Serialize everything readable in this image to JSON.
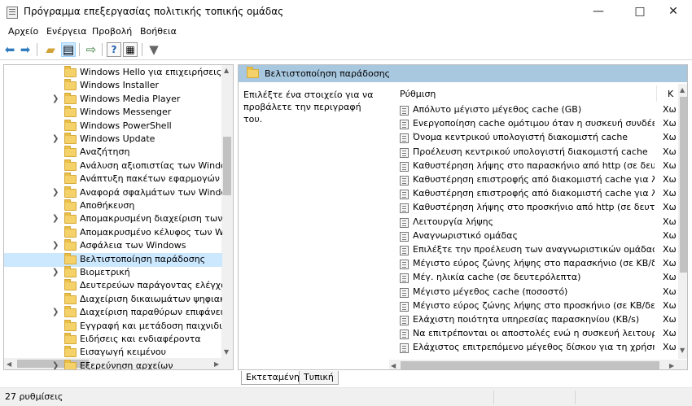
{
  "window": {
    "title": "Πρόγραμμα επεξεργασίας πολιτικής τοπικής ομάδας"
  },
  "menu": [
    "Αρχείο",
    "Ενέργεια",
    "Προβολή",
    "Βοήθεια"
  ],
  "toolbar_icons": [
    "back-arrow-icon",
    "forward-arrow-icon",
    "up-folder-icon",
    "show-tree-icon",
    "export-list-icon",
    "help-icon",
    "properties-icon",
    "filter-icon"
  ],
  "tree": [
    {
      "label": "Windows Hello για επιχειρήσεις",
      "expandable": false
    },
    {
      "label": "Windows Installer",
      "expandable": false
    },
    {
      "label": "Windows Media Player",
      "expandable": true
    },
    {
      "label": "Windows Messenger",
      "expandable": false
    },
    {
      "label": "Windows PowerShell",
      "expandable": false
    },
    {
      "label": "Windows Update",
      "expandable": true
    },
    {
      "label": "Αναζήτηση",
      "expandable": false
    },
    {
      "label": "Ανάλυση αξιοπιστίας των Windows",
      "expandable": false
    },
    {
      "label": "Ανάπτυξη πακέτων εφαρμογών",
      "expandable": false
    },
    {
      "label": "Αναφορά σφαλμάτων των Windows",
      "expandable": true
    },
    {
      "label": "Αποθήκευση",
      "expandable": false
    },
    {
      "label": "Απομακρυσμένη διαχείριση των Wi",
      "expandable": true
    },
    {
      "label": "Απομακρυσμένο κέλυφος των Wind",
      "expandable": false
    },
    {
      "label": "Ασφάλεια των Windows",
      "expandable": true
    },
    {
      "label": "Βελτιστοποίηση παράδοσης",
      "expandable": false,
      "selected": true
    },
    {
      "label": "Βιομετρική",
      "expandable": true
    },
    {
      "label": "Δευτερεύων παράγοντας ελέγχου τ",
      "expandable": false
    },
    {
      "label": "Διαχείριση δικαιωμάτων ψηφιακού",
      "expandable": false
    },
    {
      "label": "Διαχείριση παραθύρων επιφάνειας",
      "expandable": true
    },
    {
      "label": "Εγγραφή και μετάδοση παιχνιδιών",
      "expandable": false
    },
    {
      "label": "Ειδήσεις και ενδιαφέροντα",
      "expandable": false
    },
    {
      "label": "Εισαγωγή κειμένου",
      "expandable": false
    },
    {
      "label": "Εξερεύνηση αρχείων",
      "expandable": true
    }
  ],
  "right_title": "Βελτιστοποίηση παράδοσης",
  "description": "Επιλέξτε ένα στοιχείο για να προβάλετε την περιγραφή του.",
  "columns": {
    "setting": "Ρύθμιση",
    "state": "Κ"
  },
  "settings": [
    {
      "label": "Απόλυτο μέγιστο μέγεθος cache (GB)",
      "state": "Χω"
    },
    {
      "label": "Ενεργοποίηση cache ομότιμου όταν η συσκευή συνδέεται ...",
      "state": "Χω"
    },
    {
      "label": "Όνομα κεντρικού υπολογιστή διακομιστή cache",
      "state": "Χω"
    },
    {
      "label": "Προέλευση κεντρικού υπολογιστή διακομιστή cache",
      "state": "Χω"
    },
    {
      "label": "Καθυστέρηση λήψης στο παρασκήνιο από http (σε δευτερ...",
      "state": "Χω"
    },
    {
      "label": "Καθυστέρηση επιστροφής από διακομιστή cache για λήψη...",
      "state": "Χω"
    },
    {
      "label": "Καθυστέρηση επιστροφής από διακομιστή cache για λήψη...",
      "state": "Χω"
    },
    {
      "label": "Καθυστέρηση λήψης στο προσκήνιο από http (σε δευτερο...",
      "state": "Χω"
    },
    {
      "label": "Λειτουργία λήψης",
      "state": "Χω"
    },
    {
      "label": "Αναγνωριστικό ομάδας",
      "state": "Χω"
    },
    {
      "label": "Επιλέξτε την προέλευση των αναγνωριστικών ομάδας",
      "state": "Χω"
    },
    {
      "label": "Μέγιστο εύρος ζώνης λήψης στο παρασκήνιο (σε KB/δευτ.)",
      "state": "Χω"
    },
    {
      "label": "Μέγ. ηλικία cache (σε δευτερόλεπτα)",
      "state": "Χω"
    },
    {
      "label": "Μέγιστο μέγεθος cache (ποσοστό)",
      "state": "Χω"
    },
    {
      "label": "Μέγιστο εύρος ζώνης λήψης στο προσκήνιο (σε KB/δευτ.)",
      "state": "Χω"
    },
    {
      "label": "Ελάχιστη ποιότητα υπηρεσίας παρασκηνίου (KB/s)",
      "state": "Χω"
    },
    {
      "label": "Να επιτρέπονται οι αποστολές ενώ η συσκευή λειτουργεί μ...",
      "state": "Χω"
    },
    {
      "label": "Ελάχιστος επιτρεπόμενο μέγεθος δίσκου για τη χρήση cach...",
      "state": "Χω"
    }
  ],
  "tabs": [
    "Εκτεταμένη",
    "Τυπική"
  ],
  "status": "27 ρυθμίσεις"
}
